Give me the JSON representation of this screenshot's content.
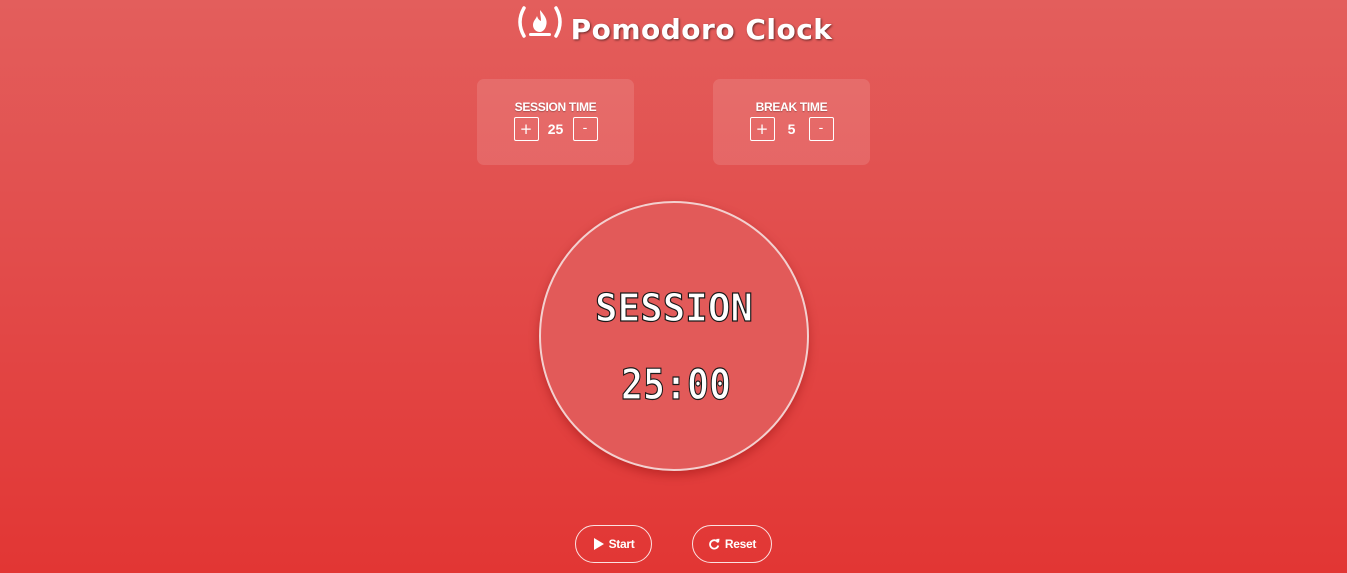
{
  "app": {
    "title": "Pomodoro Clock",
    "logo_icon": "freecodecamp-flame-icon"
  },
  "session_setting": {
    "label": "SESSION TIME",
    "value": "25",
    "plus_label": "+",
    "minus_label": "-"
  },
  "break_setting": {
    "label": "BREAK TIME",
    "value": "5",
    "plus_label": "+",
    "minus_label": "-"
  },
  "clock": {
    "mode": "SESSION",
    "time": "25:00"
  },
  "controls": {
    "start_label": "Start",
    "start_icon": "play-icon",
    "reset_label": "Reset",
    "reset_icon": "refresh-icon"
  },
  "colors": {
    "background_top": "#e35e5c",
    "background_bottom": "#e23634",
    "clock_face": "#e25a59",
    "text": "#ffffff"
  }
}
